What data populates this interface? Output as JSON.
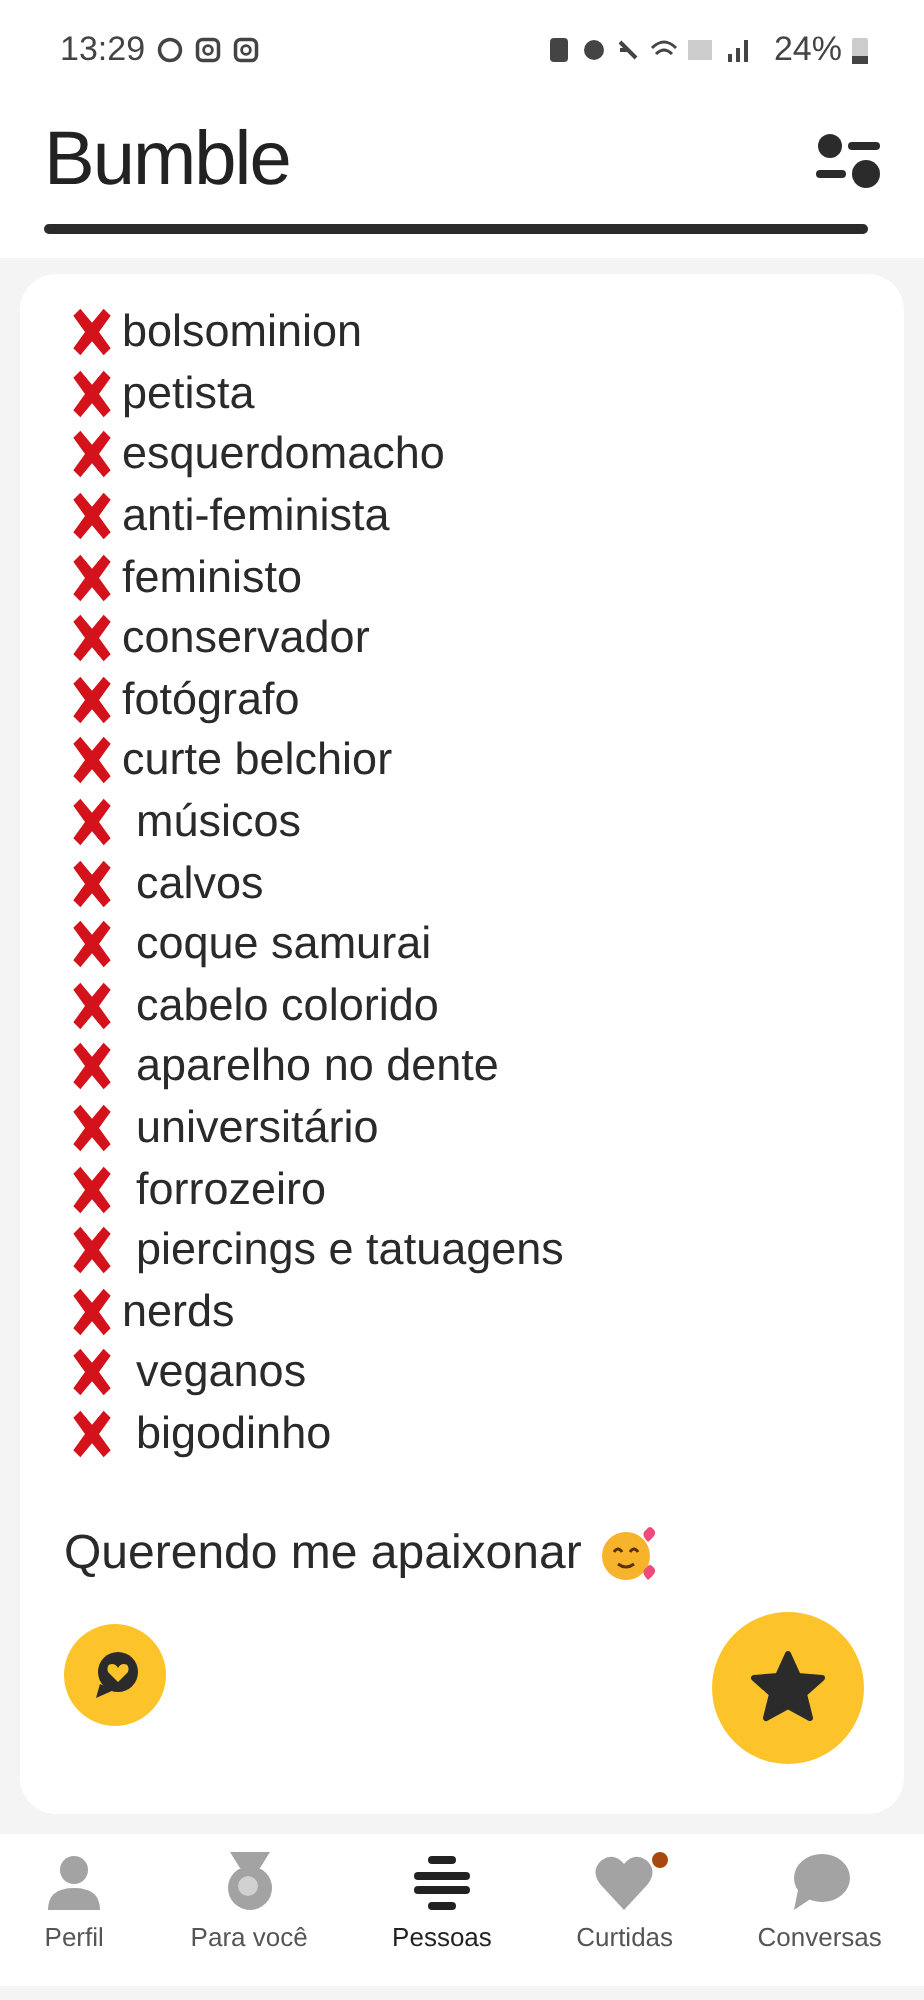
{
  "status_bar": {
    "time": "13:29",
    "battery": "24%"
  },
  "header": {
    "title": "Bumble"
  },
  "profile": {
    "dealbreakers": [
      {
        "text": "bolsominion",
        "spaced": false
      },
      {
        "text": "petista",
        "spaced": false
      },
      {
        "text": "esquerdomacho",
        "spaced": false
      },
      {
        "text": "anti-feminista",
        "spaced": false
      },
      {
        "text": "feministo",
        "spaced": false
      },
      {
        "text": "conservador",
        "spaced": false
      },
      {
        "text": "fotógrafo",
        "spaced": false
      },
      {
        "text": "curte belchior",
        "spaced": false
      },
      {
        "text": "músicos",
        "spaced": true
      },
      {
        "text": "calvos",
        "spaced": true
      },
      {
        "text": "coque samurai",
        "spaced": true
      },
      {
        "text": "cabelo colorido",
        "spaced": true
      },
      {
        "text": "aparelho no dente",
        "spaced": true
      },
      {
        "text": "universitário",
        "spaced": true
      },
      {
        "text": "forrozeiro",
        "spaced": true
      },
      {
        "text": "piercings e tatuagens",
        "spaced": true
      },
      {
        "text": "nerds",
        "spaced": false
      },
      {
        "text": "veganos",
        "spaced": true
      },
      {
        "text": "bigodinho",
        "spaced": true
      }
    ],
    "tagline": "Querendo me apaixonar"
  },
  "nav": [
    {
      "label": "Perfil",
      "kind": "person",
      "selected": false,
      "badge": false
    },
    {
      "label": "Para você",
      "kind": "medal",
      "selected": false,
      "badge": false
    },
    {
      "label": "Pessoas",
      "kind": "stack",
      "selected": true,
      "badge": false
    },
    {
      "label": "Curtidas",
      "kind": "heart",
      "selected": false,
      "badge": true
    },
    {
      "label": "Conversas",
      "kind": "chat",
      "selected": false,
      "badge": false
    }
  ]
}
